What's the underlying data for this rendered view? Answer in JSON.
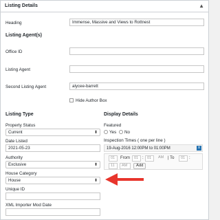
{
  "panel": {
    "title": "Listing Details",
    "toggle_icon": "▲"
  },
  "heading": {
    "label": "Heading",
    "value": "Immense, Massive and Views to Rottnest"
  },
  "agents": {
    "title": "Listing Agent(s)",
    "office_id_label": "Office ID",
    "office_id_value": "",
    "listing_agent_label": "Listing Agent",
    "listing_agent_value": "",
    "second_agent_label": "Second Listing Agent",
    "second_agent_value": "alycee-barrett",
    "hide_author_label": "Hide Author Box"
  },
  "listing_type": {
    "title": "Listing Type",
    "property_status_label": "Property Status",
    "property_status_value": "Current",
    "date_listed_label": "Date Listed",
    "date_listed_value": "2021-05-23",
    "authority_label": "Authority",
    "authority_value": "Exclusive",
    "house_category_label": "House Category",
    "house_category_value": "House",
    "unique_id_label": "Unique ID",
    "unique_id_value": "",
    "xml_mod_label": "XML Importer Mod Date",
    "xml_mod_value": ""
  },
  "display": {
    "title": "Display Details",
    "featured_label": "Featured",
    "yes_label": "Yes",
    "no_label": "No",
    "inspection_label": "Inspection Times ( one per line )",
    "inspection_entry": "19-Aug-2016 12:00PM to 01:00PM",
    "remove_icon": "x",
    "day_placeholder": "01",
    "from_label": "From",
    "hour_placeholder": "01",
    "minute_placeholder": "01",
    "ampm_placeholder": "AM",
    "colon": ":",
    "to_label": "| To",
    "month_placeholder": "01",
    "year_placeholder": "11",
    "add_label": "Add"
  },
  "annotation": {
    "arrow_color": "#e8352c"
  }
}
